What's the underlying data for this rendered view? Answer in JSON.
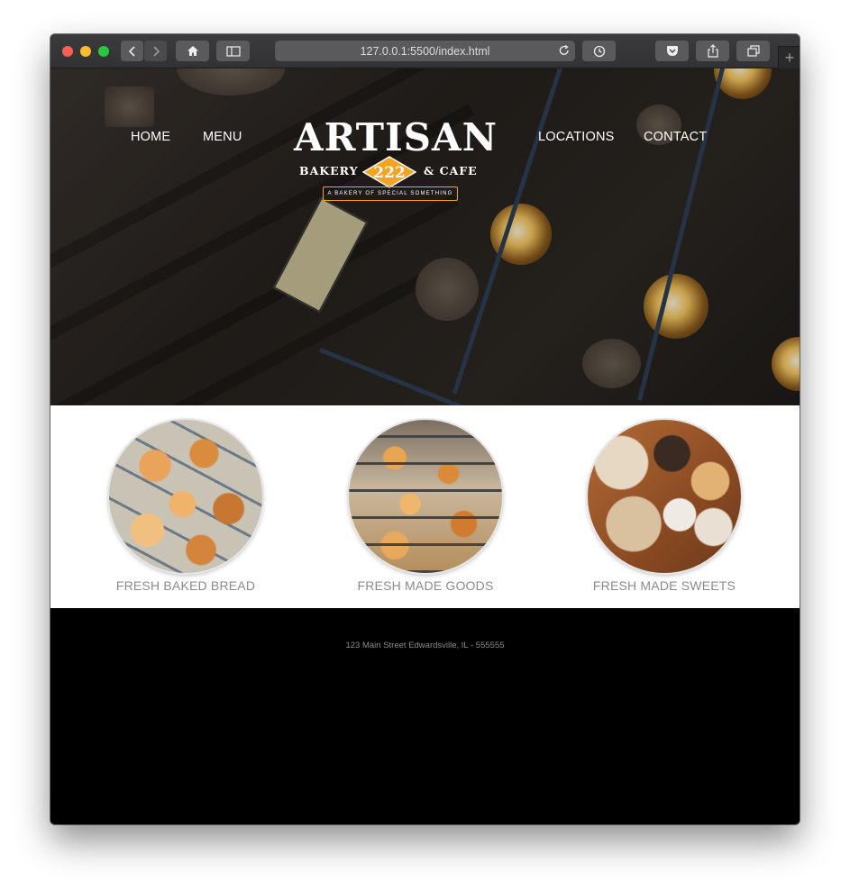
{
  "browser": {
    "url": "127.0.0.1:5500/index.html",
    "icons": [
      "back-icon",
      "forward-icon",
      "home-icon",
      "sidebar-icon",
      "reload-icon",
      "history-icon",
      "pocket-icon",
      "share-icon",
      "tabs-icon",
      "new-tab-icon"
    ]
  },
  "nav": {
    "left": [
      "HOME",
      "MENU"
    ],
    "right": [
      "LOCATIONS",
      "CONTACT"
    ]
  },
  "logo": {
    "title": "ARTISAN",
    "left_word": "BAKERY",
    "number": "222",
    "right_word": "& CAFE",
    "tagline": "A BAKERY OF SPECIAL SOMETHING",
    "accent": "#f3a521"
  },
  "features": [
    {
      "caption": "FRESH BAKED BREAD"
    },
    {
      "caption": "FRESH MADE GOODS"
    },
    {
      "caption": "FRESH MADE SWEETS"
    }
  ],
  "footer": {
    "address": "123 Main Street Edwardsville, IL - 555555"
  }
}
